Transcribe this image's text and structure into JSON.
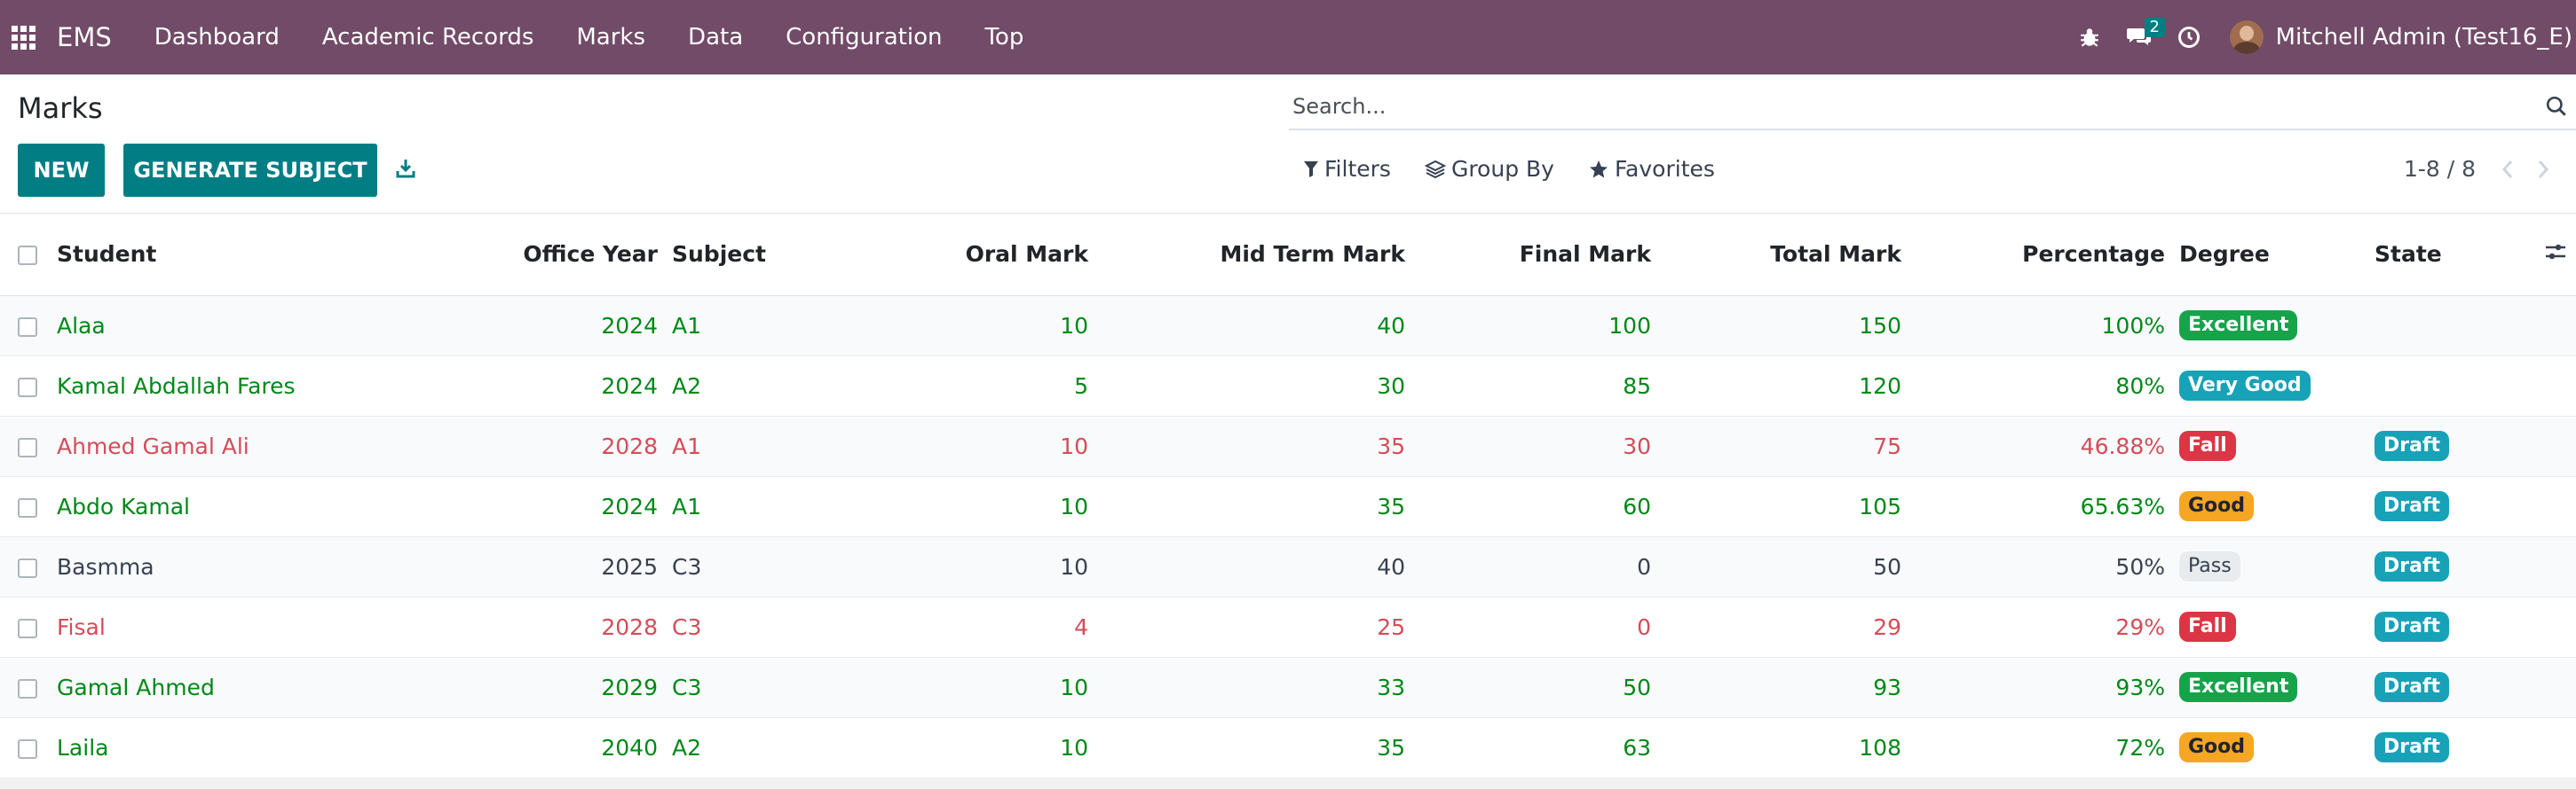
{
  "navbar": {
    "brand": "EMS",
    "menus": [
      "Dashboard",
      "Academic Records",
      "Marks",
      "Data",
      "Configuration",
      "Top"
    ],
    "messages_count": "2",
    "user_name": "Mitchell Admin (Test16_E)",
    "bg_color": "#714b67"
  },
  "page": {
    "title": "Marks",
    "search_placeholder": "Search...",
    "new_label": "NEW",
    "generate_label": "GENERATE SUBJECT",
    "filters_label": "Filters",
    "groupby_label": "Group By",
    "favorites_label": "Favorites",
    "pager": "1-8 / 8",
    "accent_color": "#017e84"
  },
  "table": {
    "headers": {
      "student": "Student",
      "office_year": "Office Year",
      "subject": "Subject",
      "oral": "Oral Mark",
      "midterm": "Mid Term Mark",
      "final": "Final Mark",
      "total": "Total Mark",
      "percentage": "Percentage",
      "degree": "Degree",
      "state": "State"
    },
    "rows": [
      {
        "student": "Alaa",
        "year": "2024",
        "subject": "A1",
        "oral": "10",
        "mid": "40",
        "final": "100",
        "total": "150",
        "pct": "100%",
        "degree": "Excellent",
        "state": ""
      },
      {
        "student": "Kamal Abdallah Fares",
        "year": "2024",
        "subject": "A2",
        "oral": "5",
        "mid": "30",
        "final": "85",
        "total": "120",
        "pct": "80%",
        "degree": "Very Good",
        "state": ""
      },
      {
        "student": "Ahmed Gamal Ali",
        "year": "2028",
        "subject": "A1",
        "oral": "10",
        "mid": "35",
        "final": "30",
        "total": "75",
        "pct": "46.88%",
        "degree": "Fall",
        "state": "Draft"
      },
      {
        "student": "Abdo Kamal",
        "year": "2024",
        "subject": "A1",
        "oral": "10",
        "mid": "35",
        "final": "60",
        "total": "105",
        "pct": "65.63%",
        "degree": "Good",
        "state": "Draft"
      },
      {
        "student": "Basmma",
        "year": "2025",
        "subject": "C3",
        "oral": "10",
        "mid": "40",
        "final": "0",
        "total": "50",
        "pct": "50%",
        "degree": "Pass",
        "state": "Draft"
      },
      {
        "student": "Fisal",
        "year": "2028",
        "subject": "C3",
        "oral": "4",
        "mid": "25",
        "final": "0",
        "total": "29",
        "pct": "29%",
        "degree": "Fall",
        "state": "Draft"
      },
      {
        "student": "Gamal Ahmed",
        "year": "2029",
        "subject": "C3",
        "oral": "10",
        "mid": "33",
        "final": "50",
        "total": "93",
        "pct": "93%",
        "degree": "Excellent",
        "state": "Draft"
      },
      {
        "student": "Laila",
        "year": "2040",
        "subject": "A2",
        "oral": "10",
        "mid": "35",
        "final": "63",
        "total": "108",
        "pct": "72%",
        "degree": "Good",
        "state": "Draft"
      }
    ],
    "row_styles": [
      "green",
      "green",
      "red",
      "green",
      "gray",
      "red",
      "green",
      "green"
    ],
    "degree_colors": {
      "Excellent": "#16a34a",
      "Very Good": "#17a2b8",
      "Fall": "#dc3545",
      "Good": "#f5a623",
      "Pass": "#e9ecef"
    },
    "state_color": "#17a2b8"
  }
}
